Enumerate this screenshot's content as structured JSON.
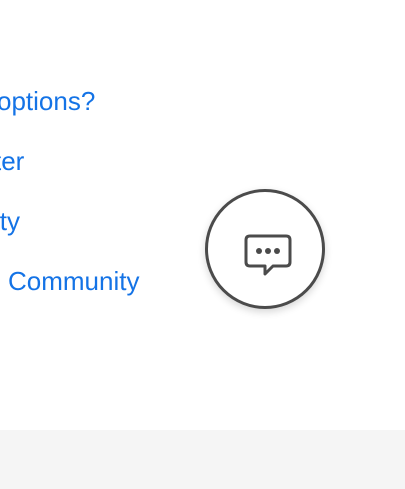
{
  "links": {
    "item1": "options?",
    "item2": "ter",
    "item3": "ity",
    "item4": "Community"
  },
  "chat": {
    "icon": "chat-bubble-ellipsis-icon"
  },
  "colors": {
    "link": "#1473e6",
    "chat_border": "#4b4b4b",
    "footer_background": "#f5f5f5"
  }
}
